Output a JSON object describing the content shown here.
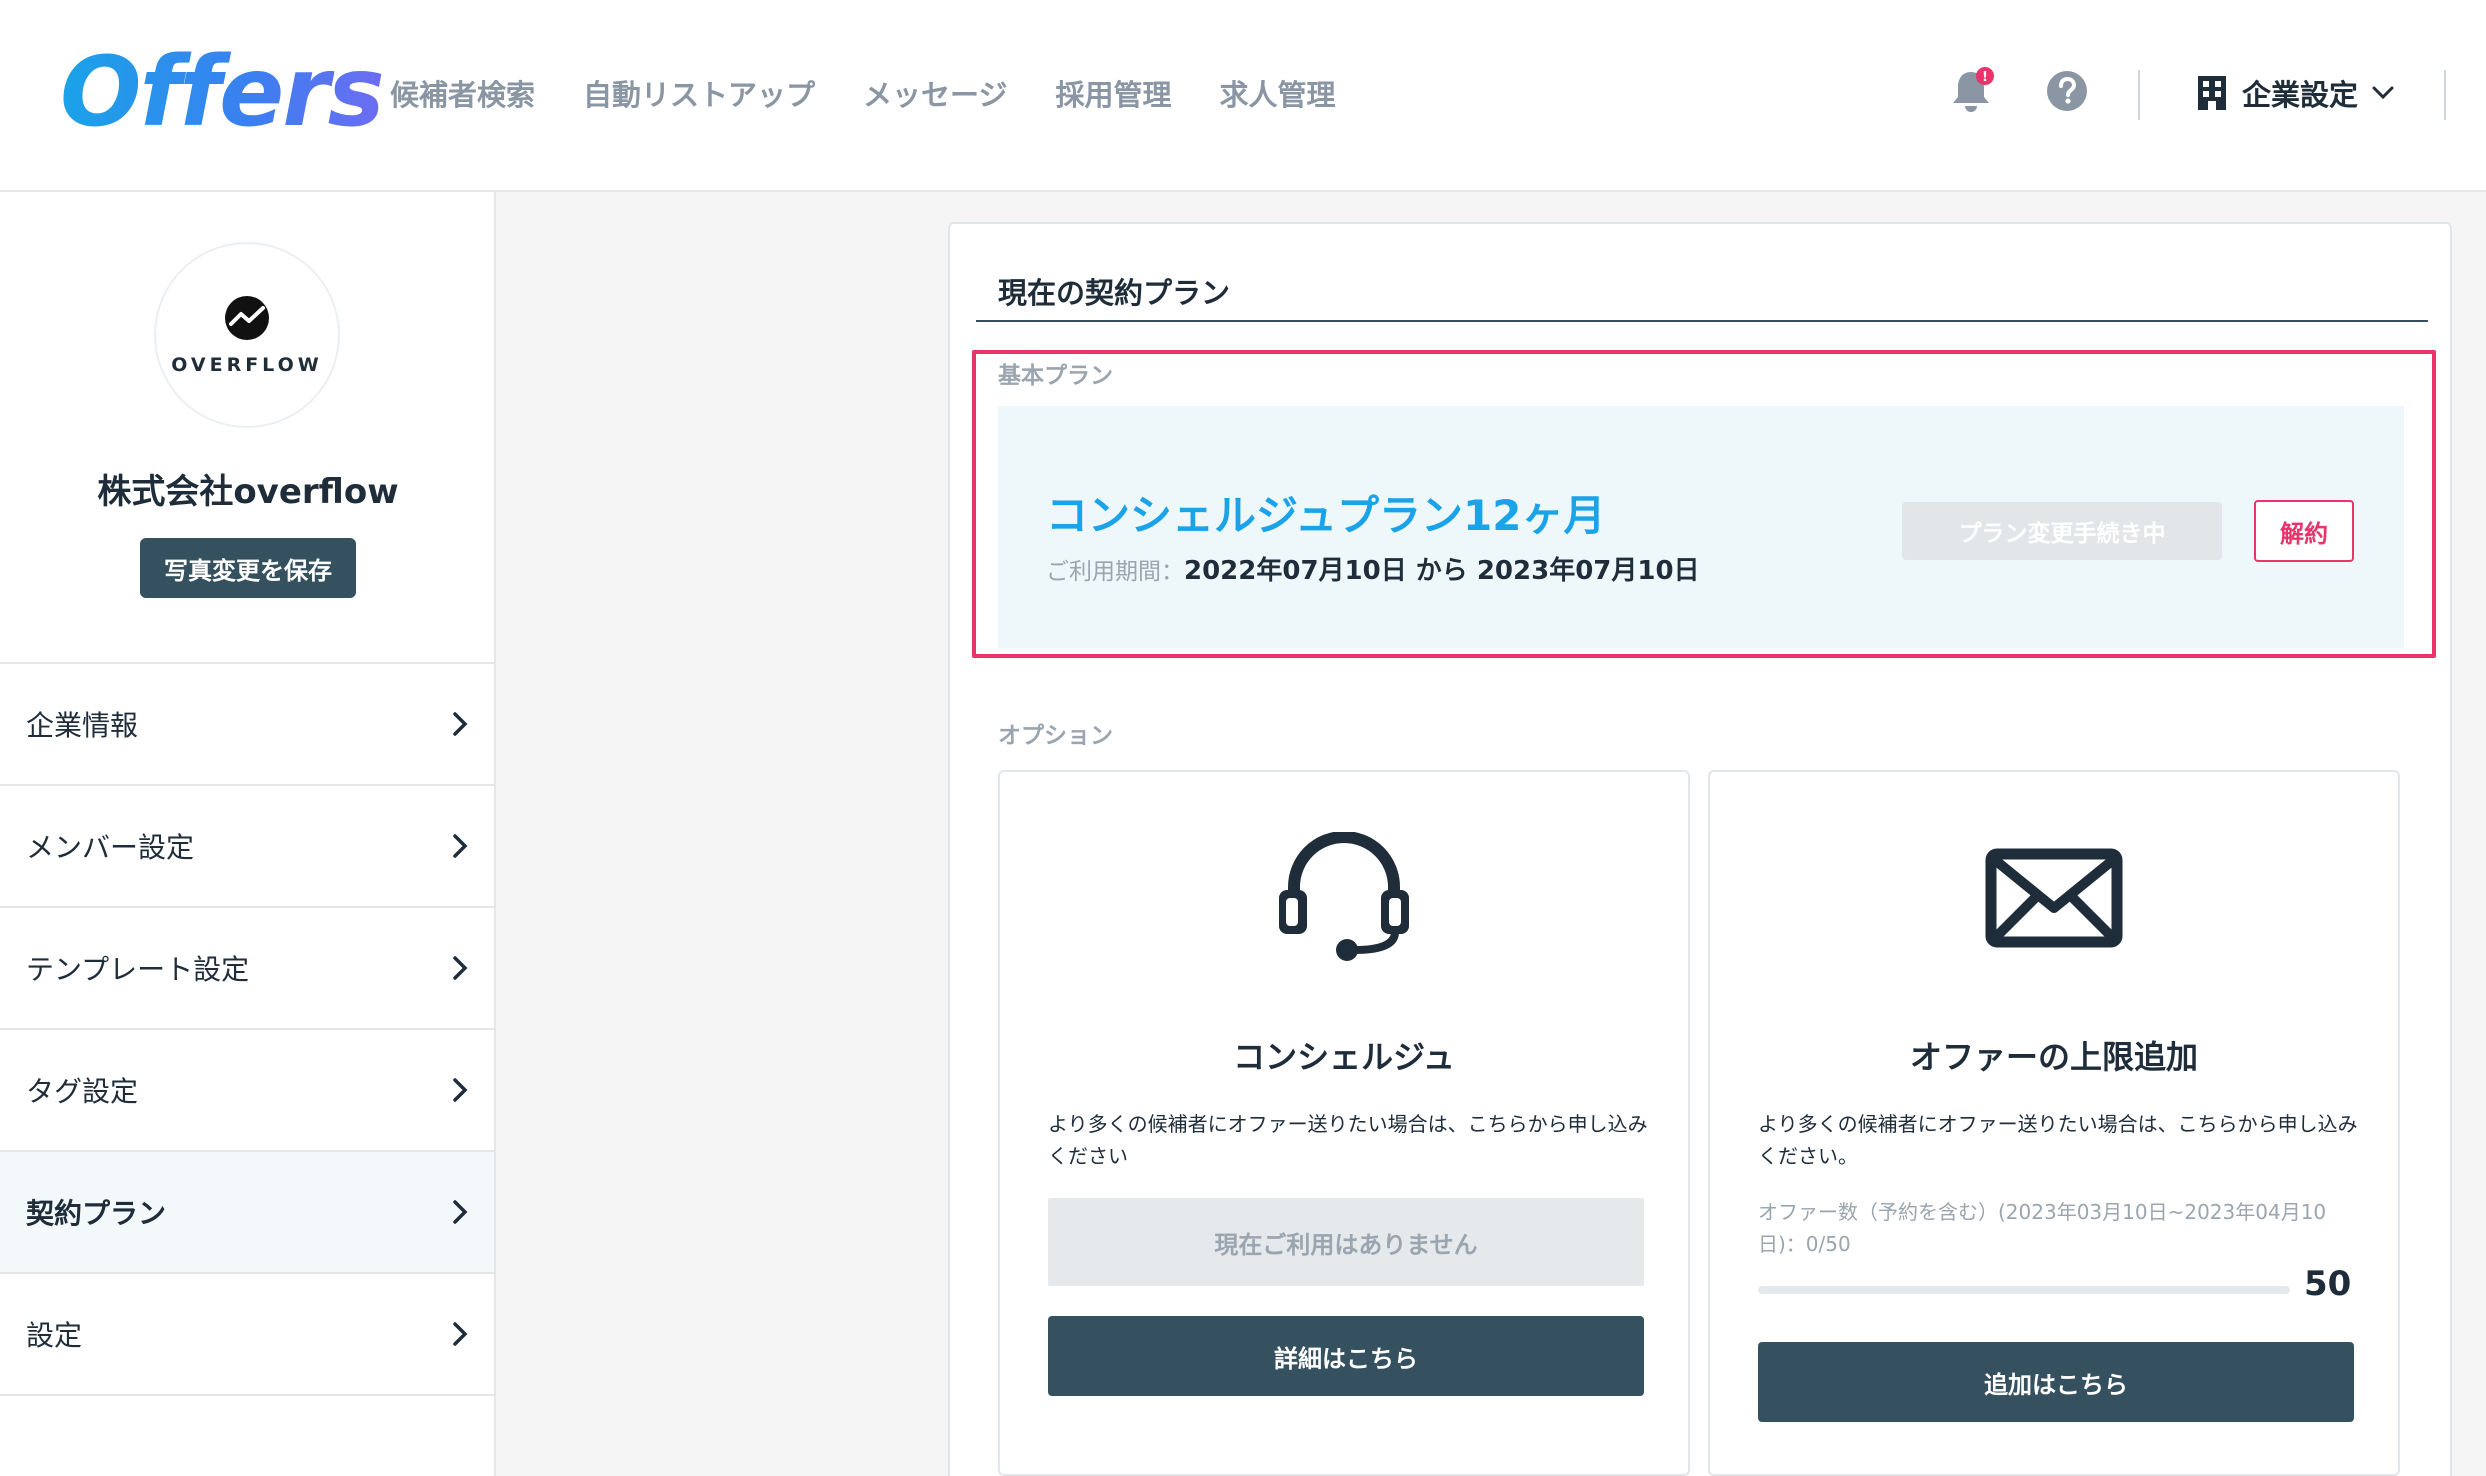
{
  "header": {
    "logo": "Offers",
    "nav": [
      "候補者検索",
      "自動リストアップ",
      "メッセージ",
      "採用管理",
      "求人管理"
    ],
    "notification_badge": "!",
    "settings_label": "企業設定"
  },
  "sidebar": {
    "avatar_text": "OVERFLOW",
    "company_name": "株式会社overflow",
    "save_photo_label": "写真変更を保存",
    "items": [
      {
        "label": "企業情報"
      },
      {
        "label": "メンバー設定"
      },
      {
        "label": "テンプレート設定"
      },
      {
        "label": "タグ設定"
      },
      {
        "label": "契約プラン"
      },
      {
        "label": "設定"
      }
    ],
    "active_item": "契約プラン"
  },
  "main": {
    "title": "現在の契約プラン",
    "basic_plan": {
      "section_label": "基本プラン",
      "name": "コンシェルジュプラン12ヶ月",
      "period_label": "ご利用期間：",
      "period_value": "2022年07月10日 から 2023年07月10日",
      "change_button": "プラン変更手続き中",
      "cancel_button": "解約"
    },
    "options": {
      "section_label": "オプション",
      "concierge": {
        "icon": "headset-icon",
        "title": "コンシェルジュ",
        "description": "より多くの候補者にオファー送りたい場合は、こちらから申し込みください",
        "status_button": "現在ご利用はありません",
        "detail_button": "詳細はこちら"
      },
      "offer_limit": {
        "icon": "mail-icon",
        "title": "オファーの上限追加",
        "description": "より多くの候補者にオファー送りたい場合は、こちらから申し込みください。",
        "quota_text": "オファー数（予約を含む）(2023年03月10日~2023年04月10日)：0/50",
        "used": 0,
        "max": 50,
        "max_label": "50",
        "add_button": "追加はこちら"
      }
    }
  },
  "colors": {
    "accent": "#1aa3e8",
    "primary_button": "#35505f",
    "highlight": "#e8336b",
    "muted": "#9aa5af"
  }
}
